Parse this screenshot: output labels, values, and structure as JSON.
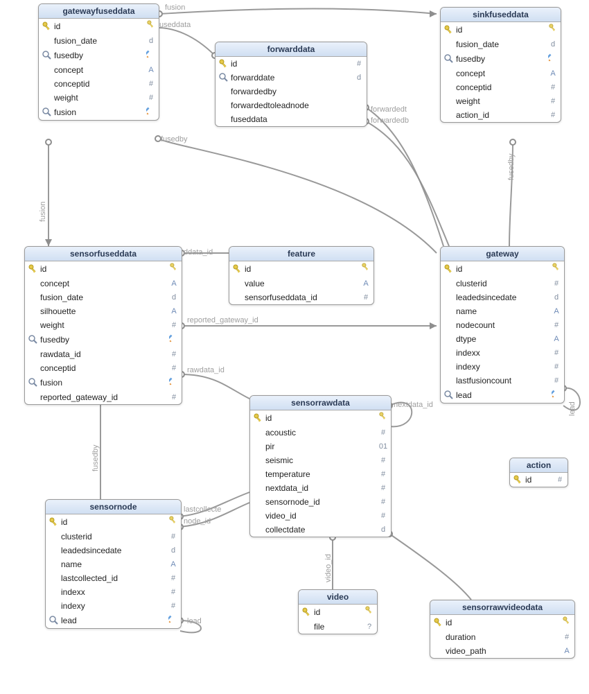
{
  "tables": {
    "gatewayfuseddata": {
      "title": "gatewayfuseddata",
      "cols": [
        {
          "icon": "key",
          "name": "id",
          "t": "key"
        },
        {
          "icon": "",
          "name": "fusion_date",
          "t": "d"
        },
        {
          "icon": "mag",
          "name": "fusedby",
          "t": "pencil"
        },
        {
          "icon": "",
          "name": "concept",
          "t": "a"
        },
        {
          "icon": "",
          "name": "conceptid",
          "t": "hash"
        },
        {
          "icon": "",
          "name": "weight",
          "t": "hash"
        },
        {
          "icon": "mag",
          "name": "fusion",
          "t": "pencil"
        }
      ]
    },
    "forwarddata": {
      "title": "forwarddata",
      "cols": [
        {
          "icon": "key",
          "name": "id",
          "t": "hash"
        },
        {
          "icon": "mag",
          "name": "forwarddate",
          "t": "d"
        },
        {
          "icon": "",
          "name": "forwardedby",
          "t": ""
        },
        {
          "icon": "",
          "name": "forwardedtoleadnode",
          "t": ""
        },
        {
          "icon": "",
          "name": "fuseddata",
          "t": ""
        }
      ]
    },
    "sinkfuseddata": {
      "title": "sinkfuseddata",
      "cols": [
        {
          "icon": "key",
          "name": "id",
          "t": "key"
        },
        {
          "icon": "",
          "name": "fusion_date",
          "t": "d"
        },
        {
          "icon": "mag",
          "name": "fusedby",
          "t": "pencil"
        },
        {
          "icon": "",
          "name": "concept",
          "t": "a"
        },
        {
          "icon": "",
          "name": "conceptid",
          "t": "hash"
        },
        {
          "icon": "",
          "name": "weight",
          "t": "hash"
        },
        {
          "icon": "",
          "name": "action_id",
          "t": "hash"
        }
      ]
    },
    "sensorfuseddata": {
      "title": "sensorfuseddata",
      "cols": [
        {
          "icon": "key",
          "name": "id",
          "t": "key"
        },
        {
          "icon": "",
          "name": "concept",
          "t": "a"
        },
        {
          "icon": "",
          "name": "fusion_date",
          "t": "d"
        },
        {
          "icon": "",
          "name": "silhouette",
          "t": "a"
        },
        {
          "icon": "",
          "name": "weight",
          "t": "hash"
        },
        {
          "icon": "mag",
          "name": "fusedby",
          "t": "pencil"
        },
        {
          "icon": "",
          "name": "rawdata_id",
          "t": "hash"
        },
        {
          "icon": "",
          "name": "conceptid",
          "t": "hash"
        },
        {
          "icon": "mag",
          "name": "fusion",
          "t": "pencil"
        },
        {
          "icon": "",
          "name": "reported_gateway_id",
          "t": "hash"
        }
      ]
    },
    "feature": {
      "title": "feature",
      "cols": [
        {
          "icon": "key",
          "name": "id",
          "t": "key"
        },
        {
          "icon": "",
          "name": "value",
          "t": "a"
        },
        {
          "icon": "",
          "name": "sensorfuseddata_id",
          "t": "hash"
        }
      ]
    },
    "gateway": {
      "title": "gateway",
      "cols": [
        {
          "icon": "key",
          "name": "id",
          "t": "key"
        },
        {
          "icon": "",
          "name": "clusterid",
          "t": "hash"
        },
        {
          "icon": "",
          "name": "leadedsincedate",
          "t": "d"
        },
        {
          "icon": "",
          "name": "name",
          "t": "a"
        },
        {
          "icon": "",
          "name": "nodecount",
          "t": "hash"
        },
        {
          "icon": "",
          "name": "dtype",
          "t": "a"
        },
        {
          "icon": "",
          "name": "indexx",
          "t": "hash"
        },
        {
          "icon": "",
          "name": "indexy",
          "t": "hash"
        },
        {
          "icon": "",
          "name": "lastfusioncount",
          "t": "hash"
        },
        {
          "icon": "mag",
          "name": "lead",
          "t": "pencil"
        }
      ]
    },
    "sensorrawdata": {
      "title": "sensorrawdata",
      "cols": [
        {
          "icon": "key",
          "name": "id",
          "t": "key"
        },
        {
          "icon": "",
          "name": "acoustic",
          "t": "hash"
        },
        {
          "icon": "",
          "name": "pir",
          "t": "01"
        },
        {
          "icon": "",
          "name": "seismic",
          "t": "hash"
        },
        {
          "icon": "",
          "name": "temperature",
          "t": "hash"
        },
        {
          "icon": "",
          "name": "nextdata_id",
          "t": "hash"
        },
        {
          "icon": "",
          "name": "sensornode_id",
          "t": "hash"
        },
        {
          "icon": "",
          "name": "video_id",
          "t": "hash"
        },
        {
          "icon": "",
          "name": "collectdate",
          "t": "d"
        }
      ]
    },
    "action": {
      "title": "action",
      "cols": [
        {
          "icon": "key",
          "name": "id",
          "t": "hash"
        }
      ]
    },
    "sensornode": {
      "title": "sensornode",
      "cols": [
        {
          "icon": "key",
          "name": "id",
          "t": "key"
        },
        {
          "icon": "",
          "name": "clusterid",
          "t": "hash"
        },
        {
          "icon": "",
          "name": "leadedsincedate",
          "t": "d"
        },
        {
          "icon": "",
          "name": "name",
          "t": "a"
        },
        {
          "icon": "",
          "name": "lastcollected_id",
          "t": "hash"
        },
        {
          "icon": "",
          "name": "indexx",
          "t": "hash"
        },
        {
          "icon": "",
          "name": "indexy",
          "t": "hash"
        },
        {
          "icon": "mag",
          "name": "lead",
          "t": "pencil"
        }
      ]
    },
    "video": {
      "title": "video",
      "cols": [
        {
          "icon": "key",
          "name": "id",
          "t": "key"
        },
        {
          "icon": "",
          "name": "file",
          "t": "qm"
        }
      ]
    },
    "sensorrawvideodata": {
      "title": "sensorrawvideodata",
      "cols": [
        {
          "icon": "key",
          "name": "id",
          "t": "key"
        },
        {
          "icon": "",
          "name": "duration",
          "t": "hash"
        },
        {
          "icon": "",
          "name": "video_path",
          "t": "a"
        }
      ]
    }
  },
  "edgeLabels": {
    "fusion": "fusion",
    "fuseddata": "useddata",
    "fusedby": "fusedby",
    "ddata_id": "ddata_id",
    "reported_gateway_id": "reported_gateway_id",
    "rawdata_id": "rawdata_id",
    "forwardedt": "forwardedt",
    "forwardedb": "forwardedb",
    "nextdata_id": "nextdata_id",
    "lead": "lead",
    "lastcollecte": "lastcollecte",
    "node_id": "node_id",
    "video_id": "video_id"
  }
}
